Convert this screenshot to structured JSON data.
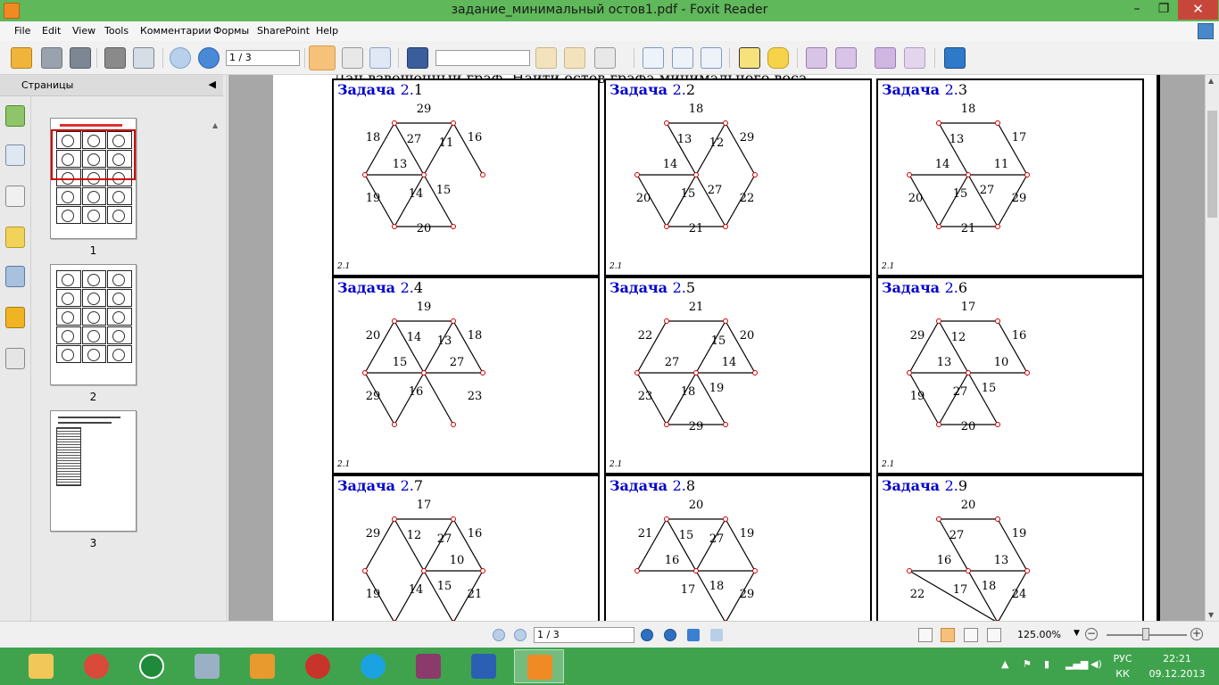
{
  "window": {
    "title": "задание_минимальный остов1.pdf - Foxit Reader"
  },
  "menu": [
    "File",
    "Edit",
    "View",
    "Tools",
    "Комментарии",
    "Формы",
    "SharePoint",
    "Help"
  ],
  "toolbar": {
    "page_value": "1 / 3",
    "search_value": ""
  },
  "sidebar": {
    "title": "Страницы",
    "thumb_labels": [
      "1",
      "2",
      "3"
    ]
  },
  "document": {
    "intro": "Дан взвешенный граф. Найти остов графа минимального веса.",
    "task_word": "Задача",
    "chapter": "2.",
    "footer_label": "2.1",
    "problems": [
      {
        "id": "1",
        "labels": [
          "29",
          "18",
          "27",
          "11",
          "16",
          "13",
          "19",
          "14",
          "15",
          "20"
        ]
      },
      {
        "id": "2",
        "labels": [
          "18",
          "13",
          "12",
          "29",
          "14",
          "20",
          "15",
          "27",
          "22",
          "21"
        ]
      },
      {
        "id": "3",
        "labels": [
          "18",
          "13",
          "17",
          "14",
          "11",
          "20",
          "15",
          "27",
          "29",
          "21"
        ]
      },
      {
        "id": "4",
        "labels": [
          "19",
          "20",
          "14",
          "13",
          "18",
          "15",
          "27",
          "29",
          "16",
          "23"
        ]
      },
      {
        "id": "5",
        "labels": [
          "21",
          "22",
          "15",
          "20",
          "27",
          "14",
          "23",
          "18",
          "19",
          "29"
        ]
      },
      {
        "id": "6",
        "labels": [
          "17",
          "29",
          "12",
          "16",
          "13",
          "10",
          "19",
          "27",
          "15",
          "20"
        ]
      },
      {
        "id": "7",
        "labels": [
          "17",
          "29",
          "12",
          "27",
          "16",
          "10",
          "19",
          "14",
          "15",
          "21"
        ]
      },
      {
        "id": "8",
        "labels": [
          "20",
          "21",
          "15",
          "27",
          "19",
          "16",
          "17",
          "18",
          "29"
        ]
      },
      {
        "id": "9",
        "labels": [
          "20",
          "27",
          "19",
          "16",
          "13",
          "22",
          "17",
          "18",
          "24"
        ]
      }
    ]
  },
  "statusbar": {
    "page_value": "1 / 3",
    "zoom": "125.00%"
  },
  "tray": {
    "lang_top": "РУС",
    "lang_bottom": "КК",
    "time": "22:21",
    "date": "09.12.2013"
  },
  "colors": {
    "accent": "#5fb85a",
    "taskbar": "#3fa34d",
    "task_title": "#0000cc",
    "vertex": "#cc0000"
  }
}
